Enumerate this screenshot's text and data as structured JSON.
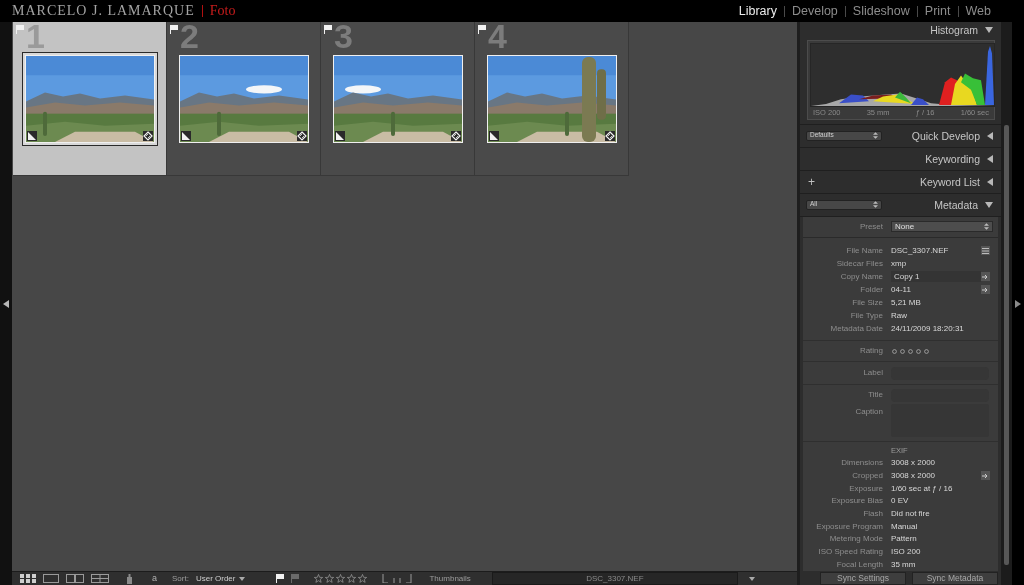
{
  "header": {
    "brand": "MARCELO J. LAMARQUE",
    "brand_suffix": "Foto",
    "modules": [
      {
        "label": "Library",
        "selected": true
      },
      {
        "label": "Develop",
        "selected": false
      },
      {
        "label": "Slideshow",
        "selected": false
      },
      {
        "label": "Print",
        "selected": false
      },
      {
        "label": "Web",
        "selected": false
      }
    ]
  },
  "grid": {
    "cells": [
      {
        "index": "1",
        "selected": true
      },
      {
        "index": "2",
        "selected": false
      },
      {
        "index": "3",
        "selected": false
      },
      {
        "index": "4",
        "selected": false
      }
    ]
  },
  "toolbar": {
    "sort_order_toggle": "a",
    "sort_label": "Sort:",
    "sort_value": "User Order",
    "rating_filter": {
      "stars": 0
    },
    "thumbnails_label": "Thumbnails",
    "filename": "DSC_3307.NEF"
  },
  "right_panel": {
    "sections": [
      {
        "title": "Histogram",
        "expanded": true,
        "kind": "plain",
        "histogram_info": [
          "ISO 200",
          "35 mm",
          "ƒ / 16",
          "1/60 sec"
        ]
      },
      {
        "title": "Quick Develop",
        "expanded": false,
        "kind": "dropdown",
        "control": "Defaults"
      },
      {
        "title": "Keywording",
        "expanded": false,
        "kind": "plain"
      },
      {
        "title": "Keyword List",
        "expanded": false,
        "kind": "button",
        "control": "+"
      },
      {
        "title": "Metadata",
        "expanded": true,
        "kind": "dropdown",
        "control": "All",
        "metadata": {
          "preset": {
            "label": "Preset",
            "value": "None"
          },
          "file_rows": [
            {
              "label": "File Name",
              "value": "DSC_3307.NEF",
              "kind": "text",
              "menu_button": true
            },
            {
              "label": "Sidecar Files",
              "value": "xmp",
              "kind": "text"
            },
            {
              "label": "Copy Name",
              "value": "Copy 1",
              "kind": "input",
              "jump_button": true
            },
            {
              "label": "Folder",
              "value": "04-11",
              "kind": "text",
              "jump_button": true
            },
            {
              "label": "File Size",
              "value": "5,21 MB",
              "kind": "text"
            },
            {
              "label": "File Type",
              "value": "Raw",
              "kind": "text"
            },
            {
              "label": "Metadata Date",
              "value": "24/11/2009 18:20:31",
              "kind": "text"
            }
          ],
          "rating": {
            "label": "Rating",
            "stars": 0
          },
          "label_row": {
            "label": "Label"
          },
          "text_fields": [
            {
              "label": "Title",
              "kind": "line"
            },
            {
              "label": "Caption",
              "kind": "area"
            }
          ],
          "exif_heading": "EXIF",
          "exif_rows": [
            {
              "label": "Dimensions",
              "value": "3008 x 2000",
              "kind": "text"
            },
            {
              "label": "Cropped",
              "value": "3008 x 2000",
              "kind": "text",
              "jump_button": true
            },
            {
              "label": "Exposure",
              "value": "1/60 sec at ƒ / 16",
              "kind": "text"
            },
            {
              "label": "Exposure Bias",
              "value": "0 EV",
              "kind": "text"
            },
            {
              "label": "Flash",
              "value": "Did not fire",
              "kind": "text"
            },
            {
              "label": "Exposure Program",
              "value": "Manual",
              "kind": "text"
            },
            {
              "label": "Metering Mode",
              "value": "Pattern",
              "kind": "text"
            },
            {
              "label": "ISO Speed Rating",
              "value": "ISO 200",
              "kind": "text"
            },
            {
              "label": "Focal Length",
              "value": "35 mm",
              "kind": "text"
            }
          ]
        }
      }
    ],
    "sync_buttons": [
      "Sync Settings",
      "Sync Metadata"
    ]
  }
}
